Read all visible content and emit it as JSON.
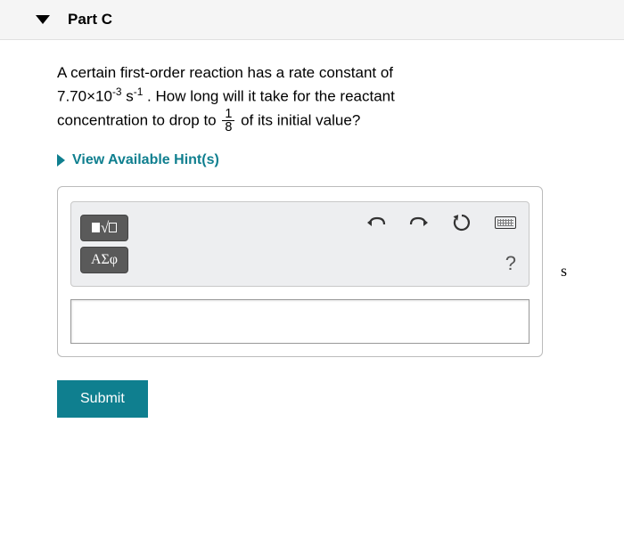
{
  "header": {
    "title": "Part C"
  },
  "question": {
    "line1": "A certain first-order reaction has a rate constant of",
    "rate_value": "7.70×10",
    "rate_exp": "-3",
    "rate_unit_base": "s",
    "rate_unit_exp": "-1",
    "line2_mid": " . How long will it take for the reactant",
    "line3_pre": "concentration to drop to ",
    "frac_num": "1",
    "frac_den": "8",
    "line3_post": " of its initial value?"
  },
  "hints": {
    "label": "View Available Hint(s)"
  },
  "toolbar": {
    "greek_label": "ΑΣφ",
    "help_label": "?"
  },
  "answer": {
    "value": "",
    "unit": "s"
  },
  "actions": {
    "submit_label": "Submit"
  }
}
